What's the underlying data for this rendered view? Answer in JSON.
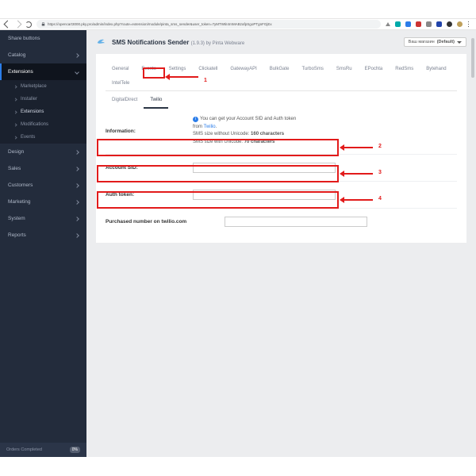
{
  "browser": {
    "url": "https://opencart3000.pky.pro/admin/index.php?route=extension/module/pinta_sms_sender&user_token=7yMTWtiI4rnMABzafpSgoPTgnFGjEx"
  },
  "sidebar": {
    "items": [
      {
        "label": "Share buttons"
      },
      {
        "label": "Catalog"
      },
      {
        "label": "Extensions"
      }
    ],
    "sub": [
      {
        "label": "Marketplace"
      },
      {
        "label": "Installer"
      },
      {
        "label": "Extensions"
      },
      {
        "label": "Modifications"
      },
      {
        "label": "Events"
      }
    ],
    "items2": [
      {
        "label": "Design"
      },
      {
        "label": "Sales"
      },
      {
        "label": "Customers"
      },
      {
        "label": "Marketing"
      },
      {
        "label": "System"
      },
      {
        "label": "Reports"
      }
    ],
    "footer": {
      "label": "Orders Completed",
      "pct": "0%"
    }
  },
  "header": {
    "title": "SMS Notifications Sender",
    "version": "(1.9.3) by Pinta Webware",
    "store_label": "Ваш магазин",
    "store_value": "(Default)"
  },
  "tabs": {
    "row1": [
      "General",
      "Events",
      "Settings",
      "Clickatell",
      "GatewayAPI",
      "BulkGate",
      "TurboSms",
      "SmsRu",
      "EPochta",
      "RedSms",
      "Bytehand",
      "IntelTele"
    ],
    "row2": [
      "DigitalDirect",
      "Twilio"
    ],
    "active": "Twilio"
  },
  "info": {
    "label": "Information:",
    "l1a": "You can get your Account SID and Auth token",
    "l1b": "from ",
    "l1link": "Twilio",
    "l1c": ".",
    "l2": "SMS size without Unicode: ",
    "l2b": "160 characters",
    "l3": "SMS size with Unicode: ",
    "l3b": "70 characters"
  },
  "fields": {
    "sid": "Account SID:",
    "token": "Auth token:",
    "number": "Purchased number on twilio.com"
  },
  "ann": {
    "n1": "1",
    "n2": "2",
    "n3": "3",
    "n4": "4"
  }
}
